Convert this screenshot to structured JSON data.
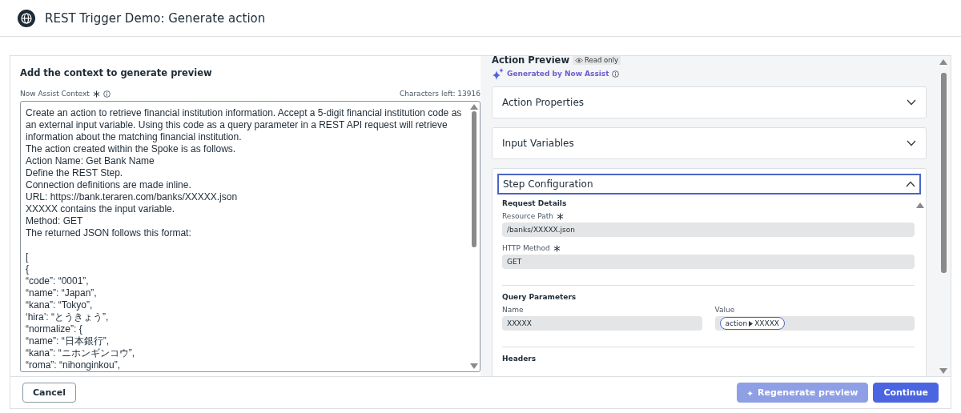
{
  "window": {
    "title": "REST Trigger Demo: Generate action"
  },
  "context": {
    "heading": "Add the context to generate preview",
    "label": "Now Assist Context",
    "required": true,
    "counter": "Characters left: 13916",
    "value": "Create an action to retrieve financial institution information. Accept a 5-digit financial institution code as an external input variable. Using this code as a query parameter in a REST API request will retrieve information about the matching financial institution.\nThe action created within the Spoke is as follows.\nAction Name: Get Bank Name\nDefine the REST Step.\nConnection definitions are made inline.\nURL: https://bank.teraren.com/banks/XXXXX.json\nXXXXX contains the input variable.\nMethod: GET\nThe returned JSON follows this format:\n\n[\n{\n“code”: “0001”,\n“name”: “Japan”,\n“kana”: “Tokyo”,\n‘hira’: “とうきょう”,\n“normalize”: {\n“name”: “日本銀行”,\n“kana”: “ニホンギンコウ”,\n“roma”: “nihonginkou”,"
  },
  "preview": {
    "title": "Action Preview",
    "badge": "Read only",
    "generated": "Generated by Now Assist",
    "accordions": [
      {
        "title": "Action Properties",
        "expanded": false,
        "focused": false
      },
      {
        "title": "Input Variables",
        "expanded": false,
        "focused": false
      },
      {
        "title": "Step Configuration",
        "expanded": true,
        "focused": true,
        "sections": [
          {
            "kind": "fields",
            "heading": "Request Details",
            "fields": [
              {
                "label": "Resource Path",
                "required": true,
                "value": "/banks/XXXXX.json"
              },
              {
                "label": "HTTP Method",
                "required": true,
                "value": "GET"
              }
            ]
          },
          {
            "kind": "table",
            "heading": "Query Parameters",
            "columns": [
              "Name",
              "Value"
            ],
            "rows": [
              [
                {
                  "kind": "text",
                  "value": "XXXXX"
                },
                {
                  "kind": "pill",
                  "parts": [
                    "action",
                    "XXXXX"
                  ]
                }
              ]
            ]
          },
          {
            "kind": "table",
            "heading": "Headers"
          }
        ]
      }
    ]
  },
  "footer": {
    "buttons": [
      {
        "label": "Cancel",
        "kind": "secondary",
        "disabled": false
      },
      {
        "label": "Regenerate preview",
        "kind": "ai",
        "disabled": true
      },
      {
        "label": "Continue",
        "kind": "primary",
        "disabled": false
      }
    ]
  }
}
